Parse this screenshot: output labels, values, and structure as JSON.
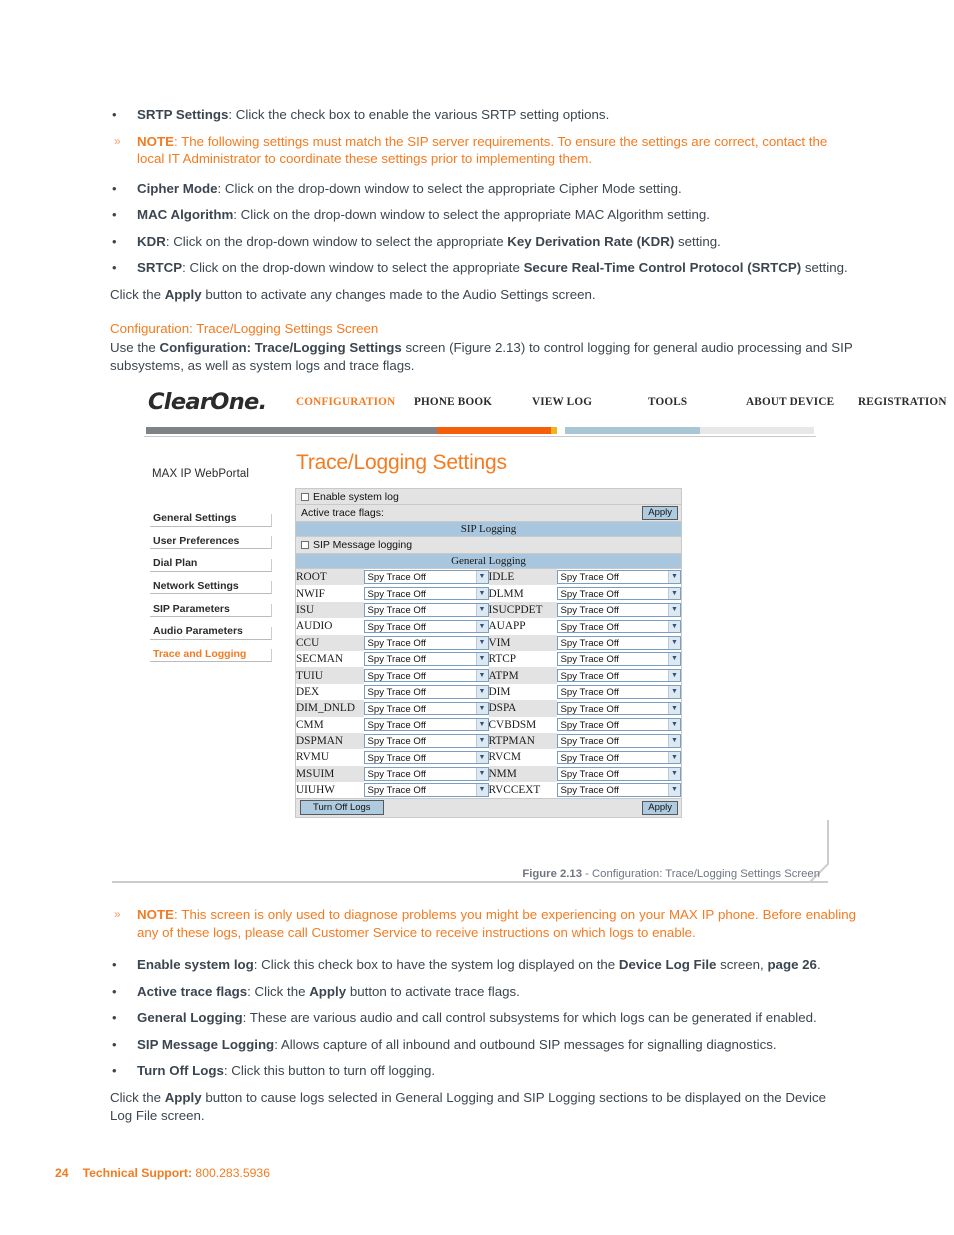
{
  "intro_bullets": [
    {
      "term": "SRTP Settings",
      "rest": ": Click the check box to enable the various SRTP setting options."
    },
    {
      "term": "Cipher Mode",
      "rest": ": Click on the drop-down window to select the appropriate Cipher Mode setting."
    },
    {
      "term": "MAC Algorithm",
      "rest": ": Click on the drop-down window to select the appropriate MAC Algorithm setting."
    },
    {
      "term": "KDR",
      "rest": ": Click on the drop-down window to select the appropriate ",
      "bold2": "Key Derivation Rate (KDR)",
      "rest2": " setting."
    },
    {
      "term": "SRTCP",
      "rest": ": Click on the drop-down window to select the appropriate ",
      "bold2": "Secure Real-Time Control Protocol (SRTCP)",
      "rest2": " setting."
    }
  ],
  "note1": {
    "marker": "»",
    "label": "NOTE",
    "text": ": The following settings must match the SIP server requirements. To ensure the settings are correct, contact the local IT Administrator to coordinate these settings prior to implementing them."
  },
  "apply_audio": {
    "pre": "Click the ",
    "bold": "Apply",
    "post": " button to activate any changes made to the Audio Settings screen."
  },
  "section_heading": "Configuration: Trace/Logging Settings Screen",
  "trace_intro": {
    "pre": "Use the ",
    "bold": "Configuration: Trace/Logging Settings",
    "post": " screen (Figure 2.13) to control logging for general audio processing and SIP subsystems, as well as system logs and trace flags."
  },
  "figure": {
    "logo": "ClearOne.",
    "nav": [
      {
        "label": "CONFIGURATION",
        "active": true
      },
      {
        "label": "PHONE BOOK",
        "active": false
      },
      {
        "label": "VIEW LOG",
        "active": false
      },
      {
        "label": "TOOLS",
        "active": false
      },
      {
        "label": "ABOUT DEVICE",
        "active": false
      },
      {
        "label": "REGISTRATION",
        "active": false
      }
    ],
    "stripe_colors": [
      "#7d8387",
      "#f4600a",
      "#f0b51e",
      "#ffffff",
      "#a8c6d4",
      "#e8e8e8"
    ],
    "portal_label": "MAX IP WebPortal",
    "sidebar": [
      {
        "label": "General Settings",
        "active": false
      },
      {
        "label": "User Preferences",
        "active": false
      },
      {
        "label": "Dial Plan",
        "active": false
      },
      {
        "label": "Network Settings",
        "active": false
      },
      {
        "label": "SIP Parameters",
        "active": false
      },
      {
        "label": "Audio Parameters",
        "active": false
      },
      {
        "label": "Trace and Logging",
        "active": true
      }
    ],
    "panel_title": "Trace/Logging Settings",
    "enable_system_log": "Enable system log",
    "active_trace_flags": "Active trace flags:",
    "apply_top": "Apply",
    "sip_logging_header": "SIP Logging",
    "sip_message_logging": "SIP Message logging",
    "general_logging_header": "General Logging",
    "select_value": "Spy Trace Off",
    "flag_rows": [
      {
        "left": "ROOT",
        "right": "IDLE"
      },
      {
        "left": "NWIF",
        "right": "DLMM"
      },
      {
        "left": "ISU",
        "right": "ISUCPDET"
      },
      {
        "left": "AUDIO",
        "right": "AUAPP"
      },
      {
        "left": "CCU",
        "right": "VIM"
      },
      {
        "left": "SECMAN",
        "right": "RTCP"
      },
      {
        "left": "TUIU",
        "right": "ATPM"
      },
      {
        "left": "DEX",
        "right": "DIM"
      },
      {
        "left": "DIM_DNLD",
        "right": "DSPA"
      },
      {
        "left": "CMM",
        "right": "CVBDSM"
      },
      {
        "left": "DSPMAN",
        "right": "RTPMAN"
      },
      {
        "left": "RVMU",
        "right": "RVCM"
      },
      {
        "left": "MSUIM",
        "right": "NMM"
      },
      {
        "left": "UIUHW",
        "right": "RVCCEXT"
      }
    ],
    "turn_off_logs": "Turn Off Logs",
    "apply_bottom": "Apply"
  },
  "caption": {
    "bold": "Figure 2.13",
    "rest": " - Configuration: Trace/Logging Settings Screen"
  },
  "note2": {
    "marker": "»",
    "label": "NOTE",
    "text": ": This screen is only used to diagnose problems you might be experiencing on your MAX IP phone. Before enabling any of these logs, please call Customer Service to receive instructions on which logs to enable."
  },
  "bullets2": [
    {
      "term": "Enable system log",
      "rest": ": Click this check box to have the system log displayed on the ",
      "bold2": "Device Log File",
      "rest2": " screen, ",
      "bold3": "page 26",
      "rest3": "."
    },
    {
      "term": "Active trace flags",
      "rest": ": Click the ",
      "bold2": "Apply",
      "rest2": " button to activate trace flags."
    },
    {
      "term": "General Logging",
      "rest": ": These are various audio and call control subsystems for which logs can be generated if enabled."
    },
    {
      "term": "SIP Message Logging",
      "rest": ": Allows capture of all inbound and outbound SIP messages for signalling diagnostics."
    },
    {
      "term": "Turn Off Logs",
      "rest": ": Click this button to turn off logging."
    }
  ],
  "closing": {
    "pre": "Click the ",
    "bold": "Apply",
    "post": " button to cause logs selected in General Logging and SIP Logging sections to be displayed on the Device Log File screen."
  },
  "footer": {
    "page": "24",
    "label": "Technical Support:",
    "phone": "800.283.5936"
  },
  "bullet_glyph": "•"
}
